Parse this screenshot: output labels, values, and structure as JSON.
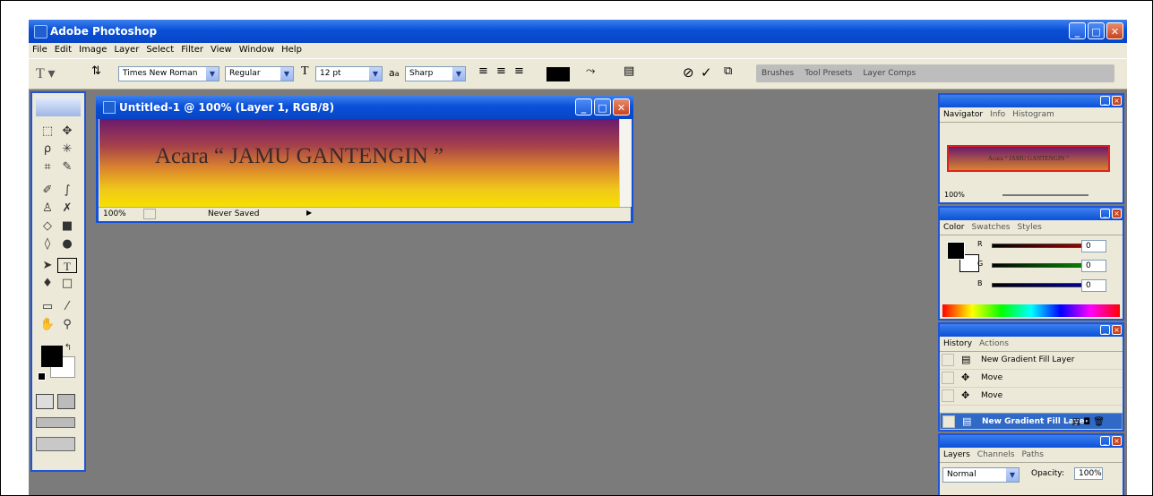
{
  "app": {
    "title": "Adobe Photoshop",
    "window_buttons": [
      "_",
      "□",
      "✕"
    ]
  },
  "menu": [
    "File",
    "Edit",
    "Image",
    "Layer",
    "Select",
    "Filter",
    "View",
    "Window",
    "Help"
  ],
  "options": {
    "font_family": "Times New Roman",
    "font_style": "Regular",
    "font_size": "12 pt",
    "aa_label": "a",
    "aa_label2": "a",
    "antialias": "Sharp",
    "tabs": [
      "Brushes",
      "Tool Presets",
      "Layer Comps"
    ]
  },
  "document": {
    "title": "Untitled-1 @ 100% (Layer 1, RGB/8)",
    "canvas_text": "Acara “ JAMU GANTENGIN ”",
    "zoom": "100%",
    "status": "Never Saved"
  },
  "navigator": {
    "tabs": [
      "Navigator",
      "Info",
      "Histogram"
    ],
    "preview_text": "Acara “ JAMU GANTENGIN ”",
    "zoom": "100%"
  },
  "color": {
    "tabs": [
      "Color",
      "Swatches",
      "Styles"
    ],
    "channels": [
      {
        "label": "R",
        "value": "0",
        "color": "#cc0000"
      },
      {
        "label": "G",
        "value": "0",
        "color": "#00aa00"
      },
      {
        "label": "B",
        "value": "0",
        "color": "#0000cc"
      }
    ]
  },
  "history": {
    "tabs": [
      "History",
      "Actions"
    ],
    "items": [
      {
        "label": "New Gradient Fill Layer",
        "icon": "document-icon"
      },
      {
        "label": "Move",
        "icon": "move-icon"
      },
      {
        "label": "Move",
        "icon": "move-icon"
      },
      {
        "label": "New Gradient Fill Layer",
        "icon": "document-icon",
        "selected": true
      }
    ]
  },
  "layers": {
    "tabs": [
      "Layers",
      "Channels",
      "Paths"
    ],
    "blend_mode": "Normal",
    "opacity_label": "Opacity:",
    "opacity": "100%"
  }
}
